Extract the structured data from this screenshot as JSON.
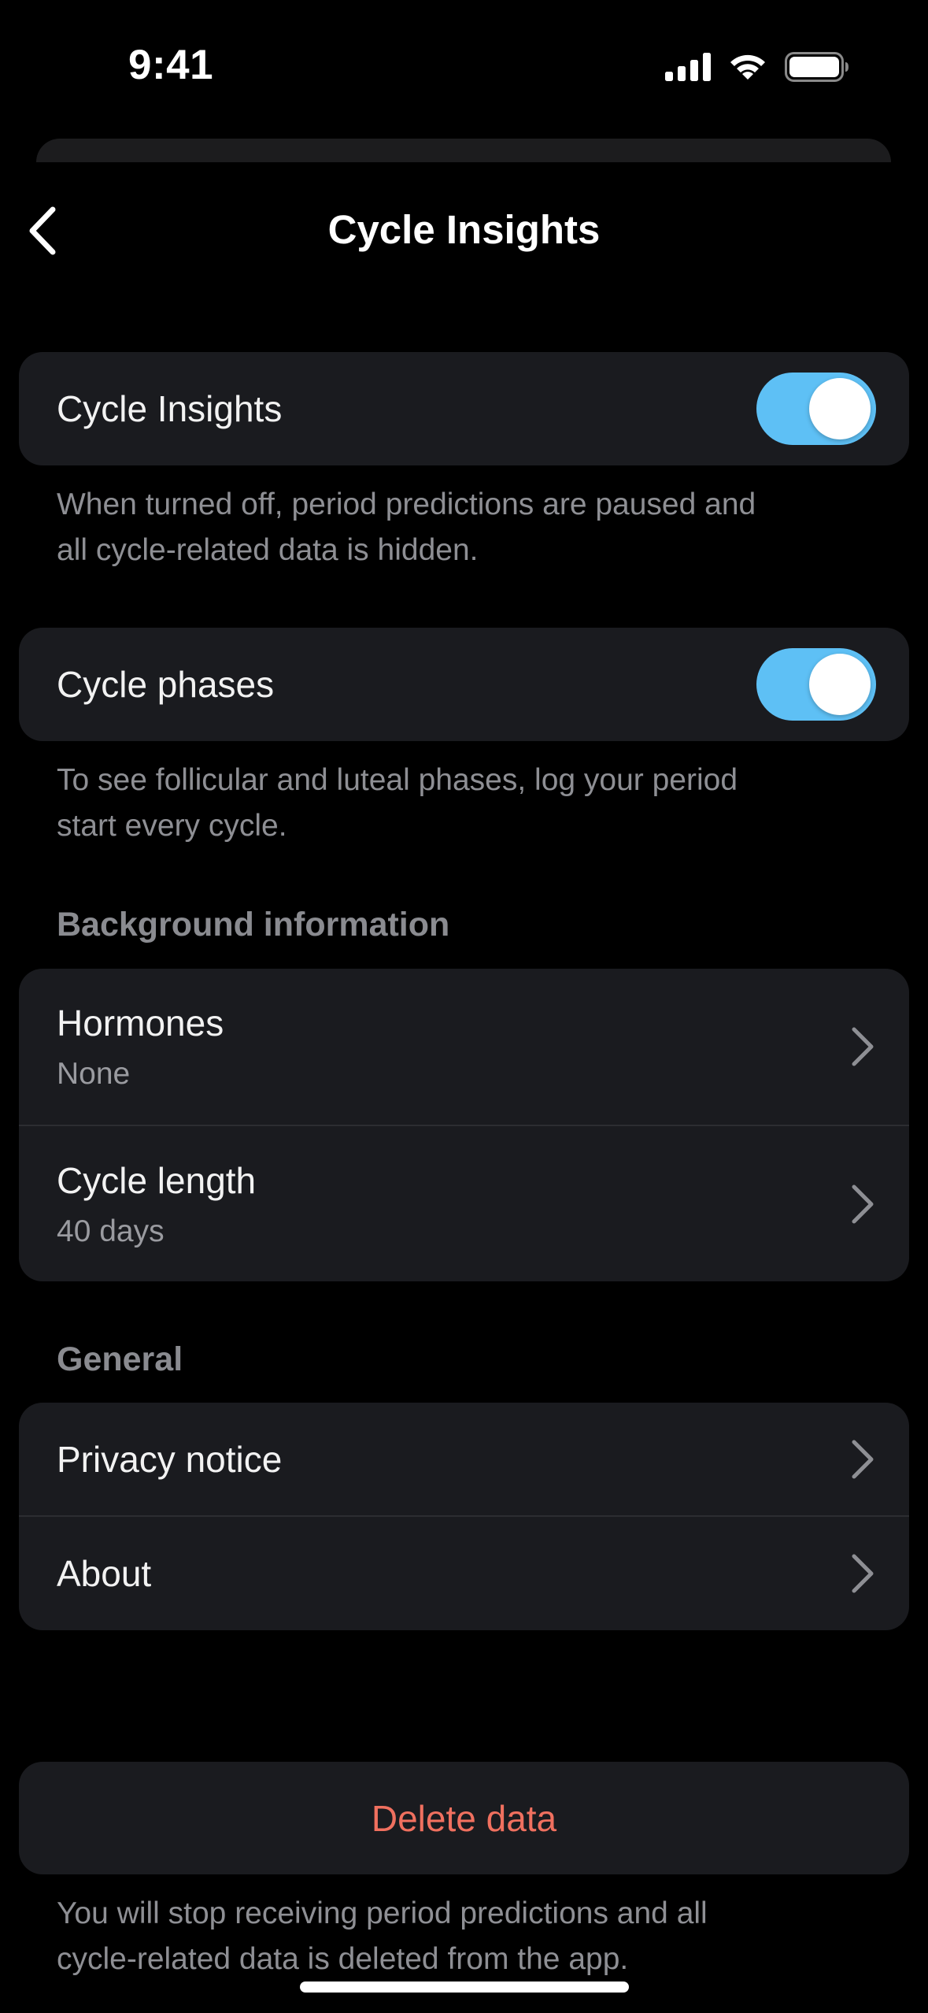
{
  "status_bar": {
    "time": "9:41"
  },
  "nav": {
    "title": "Cycle Insights"
  },
  "toggles": [
    {
      "label": "Cycle Insights",
      "on": true,
      "footnote_line1": "When turned off, period predictions are paused and",
      "footnote_line2": "all cycle-related data is hidden."
    },
    {
      "label": "Cycle phases",
      "on": true,
      "footnote_line1": "To see follicular and luteal phases, log your period",
      "footnote_line2": "start every cycle."
    }
  ],
  "background": {
    "header": "Background information",
    "items": [
      {
        "label": "Hormones",
        "value": "None"
      },
      {
        "label": "Cycle length",
        "value": "40 days"
      }
    ]
  },
  "general": {
    "header": "General",
    "items": [
      {
        "label": "Privacy notice"
      },
      {
        "label": "About"
      }
    ]
  },
  "delete": {
    "label": "Delete data",
    "footnote_line1": "You will stop receiving period predictions and all",
    "footnote_line2": "cycle-related data is deleted from the app."
  },
  "colors": {
    "background": "#000000",
    "card": "#1a1b1f",
    "toggle_on": "#5ec0f5",
    "destructive": "#f0705f",
    "secondary_text": "#8e8f94"
  },
  "icons": [
    "signal-icon",
    "wifi-icon",
    "battery-icon",
    "back-chevron-icon",
    "chevron-right-icon"
  ]
}
